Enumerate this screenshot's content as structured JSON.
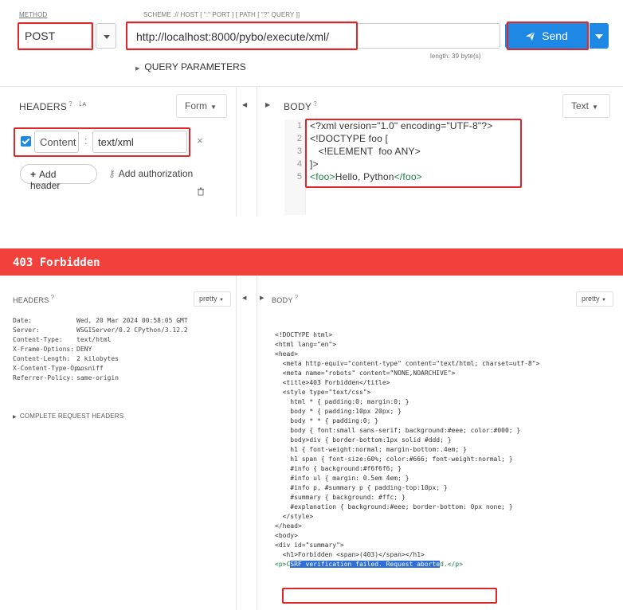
{
  "request": {
    "method_label": "METHOD",
    "method_value": "POST",
    "url_label": "SCHEME :// HOST [ \":\" PORT ] [ PATH [ \"?\" QUERY ]]",
    "url_value": "http://localhost:8000/pybo/execute/xml/",
    "length_text": "length: 39 byte(s)",
    "send_label": "Send",
    "query_parameters_label": "QUERY PARAMETERS"
  },
  "headers_panel": {
    "title": "HEADERS",
    "help": "?",
    "sort_icon": "sort-az-icon",
    "mode": "Form",
    "header_name": "Content",
    "header_separator": ":",
    "header_value": "text/xml",
    "remove": "×",
    "add_header": "Add header",
    "add_authorization": "Add authorization"
  },
  "body_panel": {
    "title": "BODY",
    "help": "?",
    "mode": "Text",
    "line_numbers": [
      "1",
      "2",
      "3",
      "4",
      "5"
    ],
    "lines": [
      "<?xml version=\"1.0\" encoding=\"UTF-8\"?>",
      "<!DOCTYPE foo [",
      "   <!ELEMENT  foo ANY>",
      "]>"
    ],
    "line5_open": "<foo>",
    "line5_text": "Hello, Python",
    "line5_close": "</foo>"
  },
  "response": {
    "status": "403 Forbidden",
    "headers_title": "HEADERS",
    "headers_mode": "pretty",
    "body_title": "BODY",
    "body_mode": "pretty",
    "help": "?",
    "complete_request_headers": "COMPLETE REQUEST HEADERS",
    "headers": [
      {
        "key": "Date:",
        "value": "Wed, 20 Mar 2024 00:58:05 GMT"
      },
      {
        "key": "Server:",
        "value": "WSGIServer/0.2 CPython/3.12.2"
      },
      {
        "key": "Content-Type:",
        "value": "text/html"
      },
      {
        "key": "X-Frame-Options:",
        "value": "DENY"
      },
      {
        "key": "Content-Length:",
        "value": "2 kilobytes"
      },
      {
        "key": "X-Content-Type-Op…",
        "value": "nosniff"
      },
      {
        "key": "Referrer-Policy:",
        "value": "same-origin"
      }
    ],
    "body_lines": [
      "<!DOCTYPE html>",
      "<html lang=\"en\">",
      "<head>",
      "  <meta http-equiv=\"content-type\" content=\"text/html; charset=utf-8\">",
      "  <meta name=\"robots\" content=\"NONE,NOARCHIVE\">",
      "  <title>403 Forbidden</title>",
      "  <style type=\"text/css\">",
      "    html * { padding:0; margin:0; }",
      "    body * { padding:10px 20px; }",
      "    body * * { padding:0; }",
      "    body { font:small sans-serif; background:#eee; color:#000; }",
      "    body>div { border-bottom:1px solid #ddd; }",
      "    h1 { font-weight:normal; margin-bottom:.4em; }",
      "    h1 span { font-size:60%; color:#666; font-weight:normal; }",
      "    #info { background:#f6f6f6; }",
      "    #info ul { margin: 0.5em 4em; }",
      "    #info p, #summary p { padding-top:10px; }",
      "    #summary { background: #ffc; }",
      "    #explanation { background:#eee; border-bottom: 0px none; }",
      "  </style>",
      "</head>",
      "<body>",
      "<div id=\"summary\">",
      "  <h1>Forbidden <span>(403)</span></h1>"
    ],
    "last_line_prefix": "<p>C",
    "last_line_selected": "SRF verification failed. Request aborte",
    "last_line_suffix": "d.</p>"
  },
  "colors": {
    "accent": "#1e88e5",
    "error_header": "#f2413c",
    "annotation": "#e0262b"
  }
}
